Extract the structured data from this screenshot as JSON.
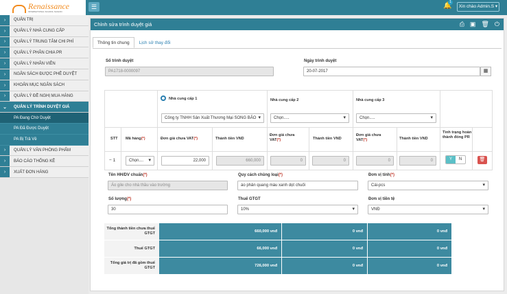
{
  "brand": {
    "name": "Renaissance",
    "subtitle": "INTERNATIONAL SCHOOL SAIGON"
  },
  "header": {
    "menu_icon": "☰",
    "notif_count": "1",
    "user_label": "Xin chào Admin.S ▾"
  },
  "sidebar": {
    "items": [
      {
        "label": "QUẢN TRỊ"
      },
      {
        "label": "QUẢN LÝ NHÀ CUNG CẤP"
      },
      {
        "label": "QUẢN LÝ TRUNG TÂM CHI PHÍ"
      },
      {
        "label": "QUẢN LÝ PHÂN CHIA PR"
      },
      {
        "label": "QUẢN LÝ NHÂN VIÊN"
      },
      {
        "label": "NGÂN SÁCH ĐƯỢC PHÊ DUYỆT"
      },
      {
        "label": "KHOẢN MỤC NGÂN SÁCH"
      },
      {
        "label": "QUẢN LÝ ĐỀ NGHỊ MUA HÀNG"
      },
      {
        "label": "QUẢN LÝ TRÌNH DUYỆT GIÁ"
      }
    ],
    "subitems": [
      {
        "label": "PA Đang Chờ Duyệt"
      },
      {
        "label": "PA Đã Được Duyệt"
      },
      {
        "label": "PA Bị Trả Về"
      }
    ],
    "items2": [
      {
        "label": "QUẢN LÝ VĂN PHÒNG PHẨM"
      },
      {
        "label": "BÁO CÁO THỐNG KÊ"
      },
      {
        "label": "XUẤT ĐƠN HÀNG"
      }
    ]
  },
  "panel": {
    "title": "Chỉnh sửa trình duyệt giá"
  },
  "tabs": [
    "Thông tin chung",
    "Lịch sử thay đổi"
  ],
  "form": {
    "so_label": "Số trình duyệt",
    "so_value": "PA1718-0000097",
    "ngay_label": "Ngày trình duyệt",
    "ngay_value": "20-07-2017"
  },
  "grid": {
    "ncc1": "Nhà cung cấp 1",
    "ncc2": "Nhà cung cấp 2",
    "ncc3": "Nhà cung cấp 3",
    "ncc1_value": "Công ty TNHH Sản Xuất Thương Mại SONG BẢO",
    "choose": "Chọn.....",
    "stt": "STT",
    "mahang": "Mã hàng",
    "dongia": "Đơn giá chưa VAT",
    "dongia2": "Đơn giá chưa",
    "vat": "VAT",
    "thanhtien": "Thành tiền VND",
    "tinhtrang": "Tình trạng hoàn thành đóng PR",
    "row_stt": "1",
    "row_ma": "Chọn....",
    "row_dg1": "22,000",
    "row_tt1": "660,000",
    "zero": "0",
    "tog_y": "Y",
    "tog_n": "N",
    "ten_label": "Tên HH/DV chuẩn",
    "ten_ph": "Áo gile cho nhà thầu vào trường",
    "quycach_label": "Quy cách chủng loại",
    "quycach_value": "áo phản quang màu xanh dọt chuối",
    "dvt_label": "Đơn vị tính",
    "dvt_value": "Cái-pcs",
    "sl_label": "Số lượng",
    "sl_value": "30",
    "thue_label": "Thuế GTGT",
    "thue_value": "10%",
    "dvtt_label": "Đơn vị tiền tệ",
    "dvtt_value": "VNĐ"
  },
  "totals": [
    {
      "label": "Tổng thành tiền chưa thuế GTGT",
      "v1": "660,000 vnđ",
      "v2": "0 vnđ",
      "v3": "0 vnđ"
    },
    {
      "label": "Thuế GTGT",
      "v1": "66,000 vnđ",
      "v2": "0 vnđ",
      "v3": "0 vnđ"
    },
    {
      "label": "Tổng giá trị đã gồm thuế GTGT",
      "v1": "726,000 vnđ",
      "v2": "0 vnđ",
      "v3": "0 vnđ"
    }
  ],
  "colors": {
    "primary": "#2f7f95",
    "danger": "#d9534f",
    "toggle": "#5bc0c7"
  }
}
